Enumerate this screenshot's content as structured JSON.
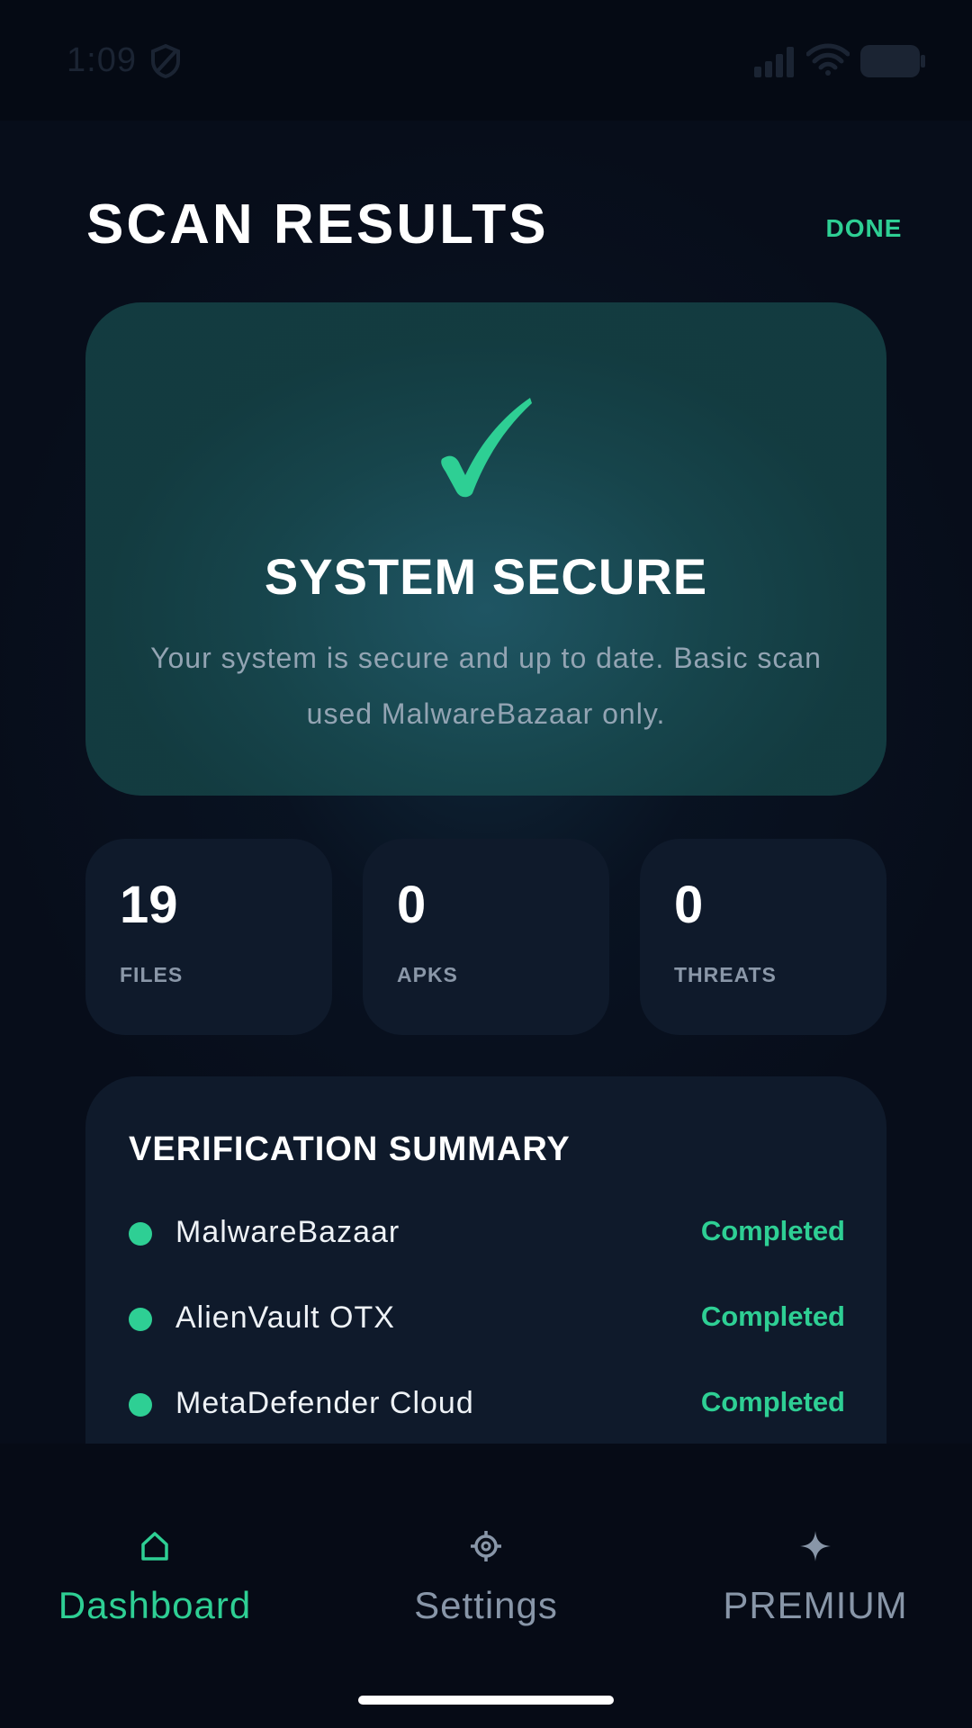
{
  "status_bar": {
    "time": "1:09",
    "icons": [
      "shield-icon",
      "signal-icon",
      "wifi-icon",
      "battery-icon"
    ]
  },
  "header": {
    "title": "SCAN RESULTS",
    "done_label": "DONE"
  },
  "hero": {
    "icon": "check-icon",
    "title": "SYSTEM SECURE",
    "description": "Your system is secure and up to date. Basic scan used MalwareBazaar only."
  },
  "stats": [
    {
      "value": "19",
      "label": "FILES"
    },
    {
      "value": "0",
      "label": "APKS"
    },
    {
      "value": "0",
      "label": "THREATS"
    }
  ],
  "summary": {
    "title": "VERIFICATION SUMMARY",
    "items": [
      {
        "name": "MalwareBazaar",
        "status": "Completed"
      },
      {
        "name": "AlienVault OTX",
        "status": "Completed"
      },
      {
        "name": "MetaDefender Cloud",
        "status": "Completed"
      }
    ]
  },
  "nav": {
    "items": [
      {
        "label": "Dashboard",
        "icon": "home-icon",
        "active": true
      },
      {
        "label": "Settings",
        "icon": "gear-icon",
        "active": false
      },
      {
        "label": "PREMIUM",
        "icon": "sparkle-icon",
        "active": false
      }
    ]
  },
  "colors": {
    "accent": "#2ecf94",
    "background": "#070d1a",
    "card": "#0f1a2b",
    "hero_card": "#1a4a54",
    "muted_text": "#8a97a8"
  }
}
